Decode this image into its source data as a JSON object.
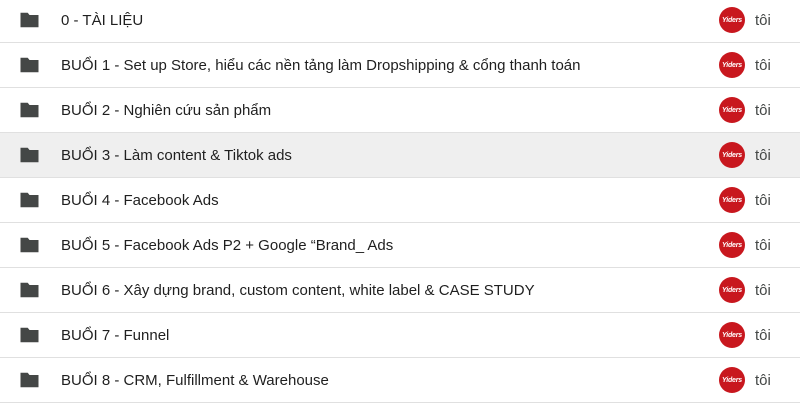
{
  "files": [
    {
      "name": "0 - TÀI LIỆU",
      "owner": "tôi",
      "selected": false
    },
    {
      "name": "BUỔI 1 - Set up Store, hiểu các nền tảng làm Dropshipping & cổng thanh toán",
      "owner": "tôi",
      "selected": false
    },
    {
      "name": "BUỔI 2 - Nghiên cứu sản phẩm",
      "owner": "tôi",
      "selected": false
    },
    {
      "name": "BUỔI 3 - Làm content & Tiktok ads",
      "owner": "tôi",
      "selected": true
    },
    {
      "name": "BUỔI 4 - Facebook Ads",
      "owner": "tôi",
      "selected": false
    },
    {
      "name": "BUỔI 5 - Facebook Ads P2 + Google “Brand_ Ads",
      "owner": "tôi",
      "selected": false
    },
    {
      "name": "BUỔI 6 - Xây dựng brand, custom content, white label & CASE STUDY",
      "owner": "tôi",
      "selected": false
    },
    {
      "name": "BUỔI 7 - Funnel",
      "owner": "tôi",
      "selected": false
    },
    {
      "name": "BUỔI 8 - CRM, Fulfillment & Warehouse",
      "owner": "tôi",
      "selected": false
    }
  ],
  "avatar_text": "Yiders",
  "colors": {
    "folder": "#444746",
    "avatar": "#c8171e",
    "selected_row": "#efefef",
    "divider": "#e0e0e0"
  }
}
